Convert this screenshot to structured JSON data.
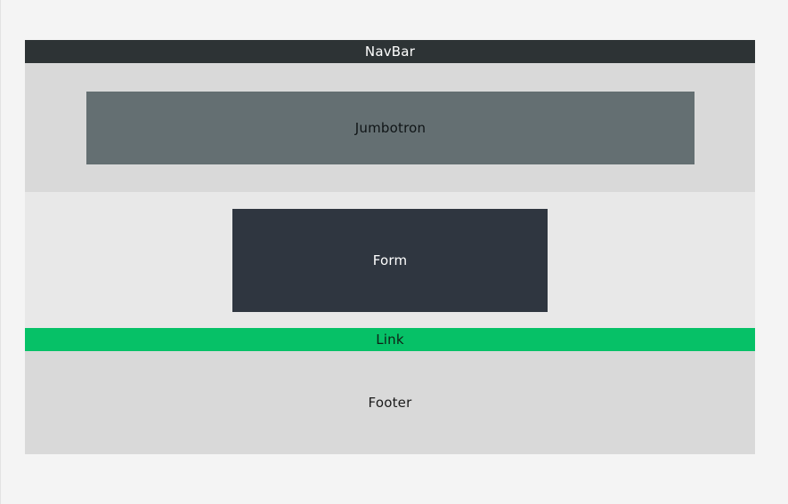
{
  "diagram": {
    "navbar": {
      "label": "NavBar",
      "color": "#2d3335"
    },
    "jumbotron": {
      "label": "Jumbotron",
      "color": "#646f72",
      "section_color": "#d9d9d9"
    },
    "form": {
      "label": "Form",
      "color": "#2f3640",
      "section_color": "#e8e8e8"
    },
    "link": {
      "label": "Link",
      "color": "#06c167"
    },
    "footer": {
      "label": "Footer",
      "color": "#d9d9d9"
    }
  }
}
